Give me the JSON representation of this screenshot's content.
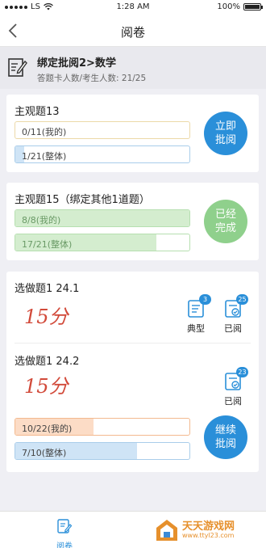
{
  "status_bar": {
    "carrier": "LS",
    "time": "1:28 AM",
    "battery": "100%"
  },
  "nav": {
    "back_glyph": "‹",
    "title": "阅卷"
  },
  "header": {
    "title": "绑定批阅2>数学",
    "subtitle": "答题卡人数/考生人数: 21/25",
    "icon": "edit-document-icon"
  },
  "cards": [
    {
      "title": "主观题13",
      "bars": [
        {
          "label": "0/11(我的)",
          "progress": 0.0
        },
        {
          "label": "1/21(整体)",
          "progress": 0.05
        }
      ],
      "action": "立即\n批阅",
      "action_color": "#2a8fd9"
    },
    {
      "title": "主观题15（绑定其他1道题）",
      "bars": [
        {
          "label": "8/8(我的)",
          "progress": 1.0
        },
        {
          "label": "17/21(整体)",
          "progress": 0.81
        }
      ],
      "action": "已经\n完成",
      "action_color": "#8fd08c"
    }
  ],
  "optional_card": {
    "items": [
      {
        "title": "选做题1   24.1",
        "score": "15分",
        "buttons": [
          {
            "caption": "典型",
            "badge": "3",
            "icon": "typical-paper-icon"
          },
          {
            "caption": "已阅",
            "badge": "25",
            "icon": "reviewed-paper-icon"
          }
        ]
      },
      {
        "title": "选做题1   24.2",
        "score": "15分",
        "buttons": [
          {
            "caption": "已阅",
            "badge": "23",
            "icon": "reviewed-paper-icon"
          }
        ],
        "bars": [
          {
            "label": "10/22(我的)",
            "progress": 0.45
          },
          {
            "label": "7/10(整体)",
            "progress": 0.7
          }
        ],
        "action": "继续\n批阅",
        "action_color": "#2a8fd9"
      }
    ]
  },
  "tabbar": {
    "tab_label": "阅卷",
    "icon": "marking-tab-icon"
  },
  "watermark": {
    "title": "天天游戏网",
    "url": "www.ttyl23.com"
  },
  "colors": {
    "accent": "#2a8fd9",
    "done_green": "#8fd08c",
    "green_fill": "#d4edcf",
    "green_border": "#b6dfb0",
    "orange_fill": "#fcdcc6",
    "orange_border": "#f3b98f",
    "blue_fill": "#cfe4f6",
    "blue_border": "#a9cdea",
    "yellow_border": "#ecd9a8",
    "score_red": "#d24a3a"
  }
}
